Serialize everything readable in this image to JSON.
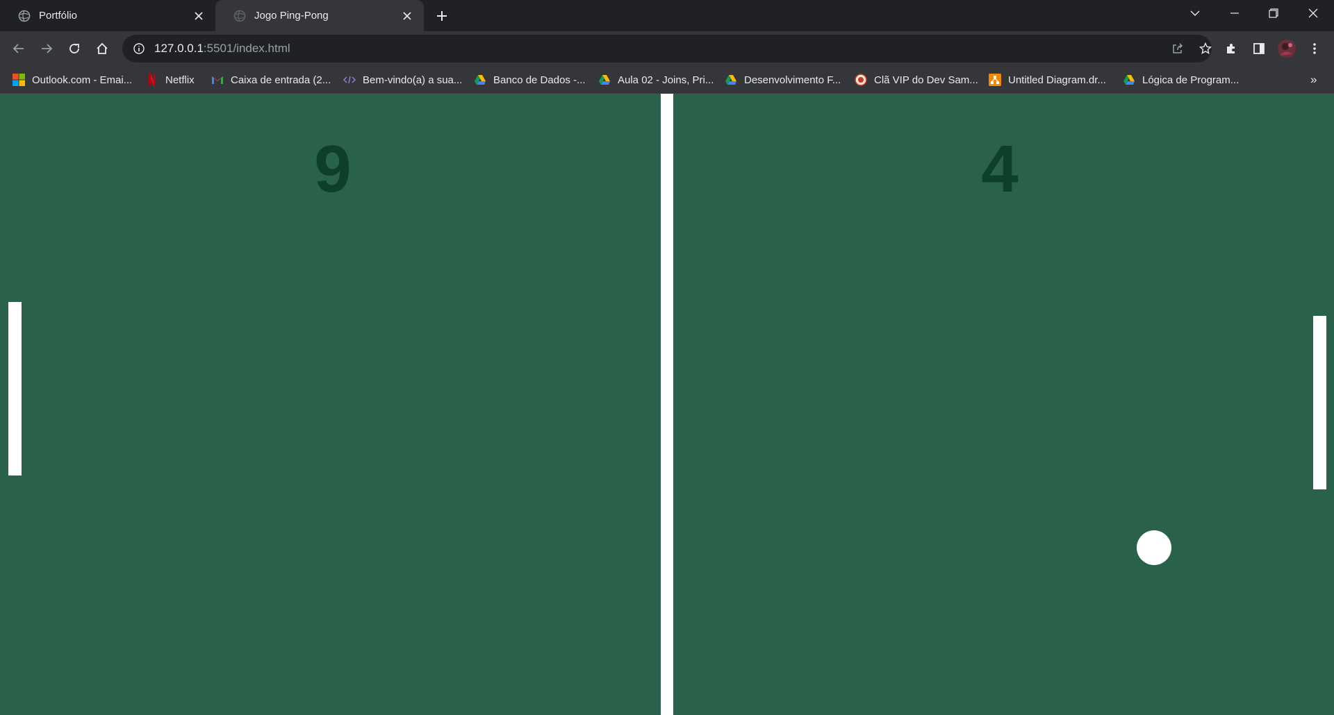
{
  "tabs": [
    {
      "title": "Portfólio",
      "active": false,
      "favicon": "globe-icon"
    },
    {
      "title": "Jogo Ping-Pong",
      "active": true,
      "favicon": "globe-icon"
    }
  ],
  "address_bar": {
    "host": "127.0.0.1",
    "rest": ":5501/index.html"
  },
  "bookmarks": [
    {
      "label": "Outlook.com - Emai...",
      "icon": "microsoft-icon"
    },
    {
      "label": "Netflix",
      "icon": "netflix-icon"
    },
    {
      "label": "Caixa de entrada (2...",
      "icon": "gmail-icon"
    },
    {
      "label": "Bem-vindo(a) a sua...",
      "icon": "code-icon"
    },
    {
      "label": "Banco de Dados -...",
      "icon": "drive-icon"
    },
    {
      "label": "Aula 02 - Joins, Pri...",
      "icon": "drive-icon"
    },
    {
      "label": "Desenvolvimento F...",
      "icon": "drive-icon"
    },
    {
      "label": "Clã VIP do Dev Sam...",
      "icon": "clan-icon"
    },
    {
      "label": "Untitled Diagram.dr...",
      "icon": "drawio-icon"
    },
    {
      "label": "Lógica de Program...",
      "icon": "drive-icon"
    }
  ],
  "bookmarks_overflow": "»",
  "game": {
    "score_left": "9",
    "score_right": "4"
  },
  "colors": {
    "field": "#29614b",
    "score": "#0e3f29",
    "paddle": "#ffffff",
    "ball": "#ffffff"
  }
}
